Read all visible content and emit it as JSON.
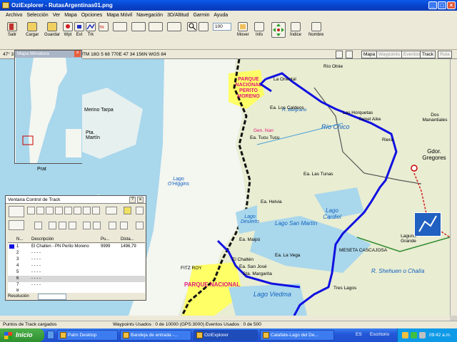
{
  "window": {
    "title": "OziExplorer - RutasArgentinas01.png",
    "min": "_",
    "max": "□",
    "close": "×"
  },
  "menu": [
    "Archivo",
    "Selección",
    "Ver",
    "Mapa",
    "Opciones",
    "Mapa Móvil",
    "Navegación",
    "3D/Altitud",
    "Garmin",
    "Ayuda"
  ],
  "toolbar": {
    "salir": "Salir",
    "cargar": "Cargar",
    "guardar": "Guardar",
    "wpt": "Wpt",
    "evt": "Evt",
    "trk": "Trk",
    "zoom_value": "100",
    "mover": "Mover",
    "info": "Info",
    "indice": "Índice",
    "nombre": "Nombre"
  },
  "statusline": {
    "coord": "47° 3",
    "utm": "UTM  18G   5 68 770E   47 34 156N  WGS 84",
    "buttons": [
      "Mapa",
      "Waypoints",
      "Eventos",
      "Track",
      "Ruta"
    ]
  },
  "minimap": {
    "title": "Mapa Miniatura",
    "close": "×"
  },
  "track_window": {
    "title": "Ventana Control de Track",
    "columns": [
      "N...",
      "Descripción",
      "Pu...",
      "Dista..."
    ],
    "rows": [
      {
        "n": "1",
        "desc": "El Chalten - PN Perito Moreno",
        "pts": "9999",
        "dist": "1496,79"
      },
      {
        "n": "2",
        "desc": "- - - -",
        "pts": "",
        "dist": ""
      },
      {
        "n": "3",
        "desc": "- - - -",
        "pts": "",
        "dist": ""
      },
      {
        "n": "4",
        "desc": "- - - -",
        "pts": "",
        "dist": ""
      },
      {
        "n": "5",
        "desc": "- - - -",
        "pts": "",
        "dist": ""
      },
      {
        "n": "6",
        "desc": "- - - -",
        "pts": "",
        "dist": ""
      },
      {
        "n": "7",
        "desc": "- - - -",
        "pts": "",
        "dist": ""
      },
      {
        "n": "8",
        "desc": "- - - -",
        "pts": "",
        "dist": ""
      }
    ],
    "resolucion": "Resolución",
    "close": "×"
  },
  "map_labels": {
    "perito": "PARQUE NACIONAL PERITO MORENO",
    "parque2": "PARQUE NACIONAL",
    "rio_olnie": "Río Olnie",
    "la_oriental": "La Oriental",
    "las_horquetas": "Las Horquetas",
    "tamel_aike": "Tamel Aike",
    "dos_manantiales": "Dos Manantiales",
    "belgrano": "R. Belgrano",
    "rio_chico": "Río Chico",
    "riera": "Riera",
    "gdor": "Gdor. Gregores",
    "lago_oh": "Lago O'Higgins",
    "lago_desierto": "Lago Desierto",
    "san_martin": "Lago San Martín",
    "lago_cardiel": "Lago Cardiel",
    "laguna_grande": "Laguna Grande",
    "meseta": "MESETA CASCAJOSA",
    "shehuen": "R. Shehuen o Chalía",
    "tres_lagos": "Tres Lagos",
    "el_chalten": "El Chaltén",
    "lago_viedma": "Lago Viedma",
    "merino": "Merino Tarpa",
    "martin": "Pta. Martín",
    "prat": "Prat",
    "fitz": "FITZ ROY",
    "helvia": "Ea. Helvia",
    "maipu": "Ea. Maipú",
    "la_vega": "Ea. La Vega",
    "san_jose": "Ea. San José",
    "margarita": "Sta. Margarita",
    "tucu": "Ea. Tucu Tucu",
    "caldeos": "Ea. Los Caldeos",
    "lastunas": "Ea. Las Tunas",
    "gen_nan": "Gen. Nan"
  },
  "statusbar": {
    "left": "Puntos de Track cargados",
    "mid": "Waypoints Usados : 0 de 10000  (GPS:3000)   Eventos Usados : 0 de 500"
  },
  "taskbar": {
    "start": "Inicio",
    "tasks": [
      "Palm Desktop",
      "Bandeja de entrada -...",
      "OziExplorer",
      "Calafate-Lago del De..."
    ],
    "lang": "ES",
    "desktop": "Escritorio",
    "clock": "09:42 a.m."
  },
  "colors": {
    "track": "#1010e0",
    "park": "#ffff00",
    "water": "#a9d7ec",
    "land": "#e9edd2"
  }
}
